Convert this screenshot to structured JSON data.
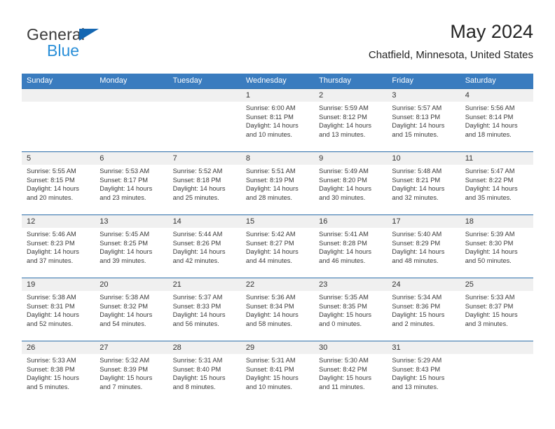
{
  "brand": {
    "name_part1": "General",
    "name_part2": "Blue",
    "triangle_color": "#1567b2",
    "blue_color": "#2a8fd8"
  },
  "header": {
    "title": "May 2024",
    "subtitle": "Chatfield, Minnesota, United States"
  },
  "colors": {
    "header_band": "#3a7cbf",
    "row_divider": "#2b6da9",
    "day_band": "#f0f0f0",
    "text": "#3a3a3a"
  },
  "weekdays": [
    "Sunday",
    "Monday",
    "Tuesday",
    "Wednesday",
    "Thursday",
    "Friday",
    "Saturday"
  ],
  "weeks": [
    [
      {
        "day": "",
        "lines": []
      },
      {
        "day": "",
        "lines": []
      },
      {
        "day": "",
        "lines": []
      },
      {
        "day": "1",
        "lines": [
          "Sunrise: 6:00 AM",
          "Sunset: 8:11 PM",
          "Daylight: 14 hours",
          "and 10 minutes."
        ]
      },
      {
        "day": "2",
        "lines": [
          "Sunrise: 5:59 AM",
          "Sunset: 8:12 PM",
          "Daylight: 14 hours",
          "and 13 minutes."
        ]
      },
      {
        "day": "3",
        "lines": [
          "Sunrise: 5:57 AM",
          "Sunset: 8:13 PM",
          "Daylight: 14 hours",
          "and 15 minutes."
        ]
      },
      {
        "day": "4",
        "lines": [
          "Sunrise: 5:56 AM",
          "Sunset: 8:14 PM",
          "Daylight: 14 hours",
          "and 18 minutes."
        ]
      }
    ],
    [
      {
        "day": "5",
        "lines": [
          "Sunrise: 5:55 AM",
          "Sunset: 8:15 PM",
          "Daylight: 14 hours",
          "and 20 minutes."
        ]
      },
      {
        "day": "6",
        "lines": [
          "Sunrise: 5:53 AM",
          "Sunset: 8:17 PM",
          "Daylight: 14 hours",
          "and 23 minutes."
        ]
      },
      {
        "day": "7",
        "lines": [
          "Sunrise: 5:52 AM",
          "Sunset: 8:18 PM",
          "Daylight: 14 hours",
          "and 25 minutes."
        ]
      },
      {
        "day": "8",
        "lines": [
          "Sunrise: 5:51 AM",
          "Sunset: 8:19 PM",
          "Daylight: 14 hours",
          "and 28 minutes."
        ]
      },
      {
        "day": "9",
        "lines": [
          "Sunrise: 5:49 AM",
          "Sunset: 8:20 PM",
          "Daylight: 14 hours",
          "and 30 minutes."
        ]
      },
      {
        "day": "10",
        "lines": [
          "Sunrise: 5:48 AM",
          "Sunset: 8:21 PM",
          "Daylight: 14 hours",
          "and 32 minutes."
        ]
      },
      {
        "day": "11",
        "lines": [
          "Sunrise: 5:47 AM",
          "Sunset: 8:22 PM",
          "Daylight: 14 hours",
          "and 35 minutes."
        ]
      }
    ],
    [
      {
        "day": "12",
        "lines": [
          "Sunrise: 5:46 AM",
          "Sunset: 8:23 PM",
          "Daylight: 14 hours",
          "and 37 minutes."
        ]
      },
      {
        "day": "13",
        "lines": [
          "Sunrise: 5:45 AM",
          "Sunset: 8:25 PM",
          "Daylight: 14 hours",
          "and 39 minutes."
        ]
      },
      {
        "day": "14",
        "lines": [
          "Sunrise: 5:44 AM",
          "Sunset: 8:26 PM",
          "Daylight: 14 hours",
          "and 42 minutes."
        ]
      },
      {
        "day": "15",
        "lines": [
          "Sunrise: 5:42 AM",
          "Sunset: 8:27 PM",
          "Daylight: 14 hours",
          "and 44 minutes."
        ]
      },
      {
        "day": "16",
        "lines": [
          "Sunrise: 5:41 AM",
          "Sunset: 8:28 PM",
          "Daylight: 14 hours",
          "and 46 minutes."
        ]
      },
      {
        "day": "17",
        "lines": [
          "Sunrise: 5:40 AM",
          "Sunset: 8:29 PM",
          "Daylight: 14 hours",
          "and 48 minutes."
        ]
      },
      {
        "day": "18",
        "lines": [
          "Sunrise: 5:39 AM",
          "Sunset: 8:30 PM",
          "Daylight: 14 hours",
          "and 50 minutes."
        ]
      }
    ],
    [
      {
        "day": "19",
        "lines": [
          "Sunrise: 5:38 AM",
          "Sunset: 8:31 PM",
          "Daylight: 14 hours",
          "and 52 minutes."
        ]
      },
      {
        "day": "20",
        "lines": [
          "Sunrise: 5:38 AM",
          "Sunset: 8:32 PM",
          "Daylight: 14 hours",
          "and 54 minutes."
        ]
      },
      {
        "day": "21",
        "lines": [
          "Sunrise: 5:37 AM",
          "Sunset: 8:33 PM",
          "Daylight: 14 hours",
          "and 56 minutes."
        ]
      },
      {
        "day": "22",
        "lines": [
          "Sunrise: 5:36 AM",
          "Sunset: 8:34 PM",
          "Daylight: 14 hours",
          "and 58 minutes."
        ]
      },
      {
        "day": "23",
        "lines": [
          "Sunrise: 5:35 AM",
          "Sunset: 8:35 PM",
          "Daylight: 15 hours",
          "and 0 minutes."
        ]
      },
      {
        "day": "24",
        "lines": [
          "Sunrise: 5:34 AM",
          "Sunset: 8:36 PM",
          "Daylight: 15 hours",
          "and 2 minutes."
        ]
      },
      {
        "day": "25",
        "lines": [
          "Sunrise: 5:33 AM",
          "Sunset: 8:37 PM",
          "Daylight: 15 hours",
          "and 3 minutes."
        ]
      }
    ],
    [
      {
        "day": "26",
        "lines": [
          "Sunrise: 5:33 AM",
          "Sunset: 8:38 PM",
          "Daylight: 15 hours",
          "and 5 minutes."
        ]
      },
      {
        "day": "27",
        "lines": [
          "Sunrise: 5:32 AM",
          "Sunset: 8:39 PM",
          "Daylight: 15 hours",
          "and 7 minutes."
        ]
      },
      {
        "day": "28",
        "lines": [
          "Sunrise: 5:31 AM",
          "Sunset: 8:40 PM",
          "Daylight: 15 hours",
          "and 8 minutes."
        ]
      },
      {
        "day": "29",
        "lines": [
          "Sunrise: 5:31 AM",
          "Sunset: 8:41 PM",
          "Daylight: 15 hours",
          "and 10 minutes."
        ]
      },
      {
        "day": "30",
        "lines": [
          "Sunrise: 5:30 AM",
          "Sunset: 8:42 PM",
          "Daylight: 15 hours",
          "and 11 minutes."
        ]
      },
      {
        "day": "31",
        "lines": [
          "Sunrise: 5:29 AM",
          "Sunset: 8:43 PM",
          "Daylight: 15 hours",
          "and 13 minutes."
        ]
      },
      {
        "day": "",
        "lines": []
      }
    ]
  ]
}
